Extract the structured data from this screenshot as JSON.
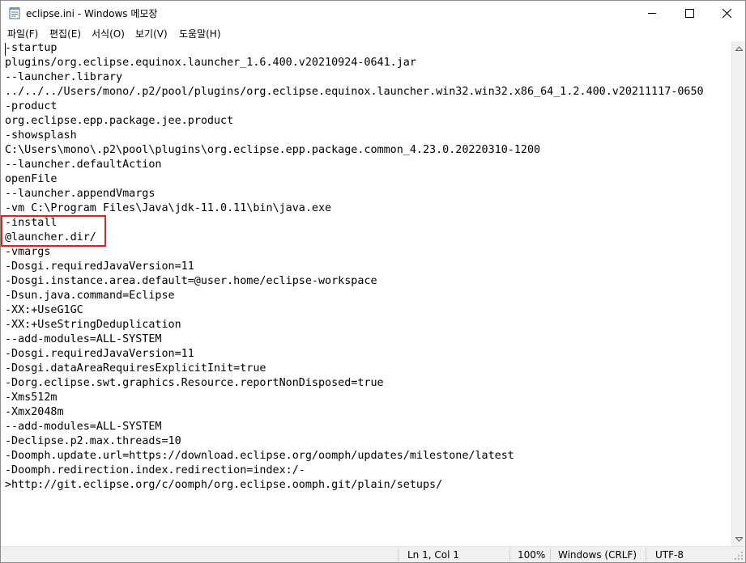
{
  "window": {
    "title": "eclipse.ini - Windows 메모장",
    "icon": "notepad-icon",
    "controls": [
      "minimize-icon",
      "maximize-icon",
      "close-icon"
    ]
  },
  "menu": [
    "파일(F)",
    "편집(E)",
    "서식(O)",
    "보기(V)",
    "도움말(H)"
  ],
  "editor": {
    "lines": [
      "-startup",
      "plugins/org.eclipse.equinox.launcher_1.6.400.v20210924-0641.jar",
      "--launcher.library",
      "../../../Users/mono/.p2/pool/plugins/org.eclipse.equinox.launcher.win32.win32.x86_64_1.2.400.v20211117-0650",
      "-product",
      "org.eclipse.epp.package.jee.product",
      "-showsplash",
      "C:\\Users\\mono\\.p2\\pool\\plugins\\org.eclipse.epp.package.common_4.23.0.20220310-1200",
      "--launcher.defaultAction",
      "openFile",
      "--launcher.appendVmargs",
      "-vm C:\\Program Files\\Java\\jdk-11.0.11\\bin\\java.exe",
      "-install",
      "@launcher.dir/",
      "-vmargs",
      "-Dosgi.requiredJavaVersion=11",
      "-Dosgi.instance.area.default=@user.home/eclipse-workspace",
      "-Dsun.java.command=Eclipse",
      "-XX:+UseG1GC",
      "-XX:+UseStringDeduplication",
      "--add-modules=ALL-SYSTEM",
      "-Dosgi.requiredJavaVersion=11",
      "-Dosgi.dataAreaRequiresExplicitInit=true",
      "-Dorg.eclipse.swt.graphics.Resource.reportNonDisposed=true",
      "-Xms512m",
      "-Xmx2048m",
      "--add-modules=ALL-SYSTEM",
      "-Declipse.p2.max.threads=10",
      "-Doomph.update.url=https://download.eclipse.org/oomph/updates/milestone/latest",
      "-Doomph.redirection.index.redirection=index:/-",
      ">http://git.eclipse.org/c/oomph/org.eclipse.oomph.git/plain/setups/"
    ],
    "highlight_color": "#e02020"
  },
  "status": {
    "position": "Ln 1, Col 1",
    "zoom": "100%",
    "line_ending": "Windows (CRLF)",
    "encoding": "UTF-8"
  }
}
